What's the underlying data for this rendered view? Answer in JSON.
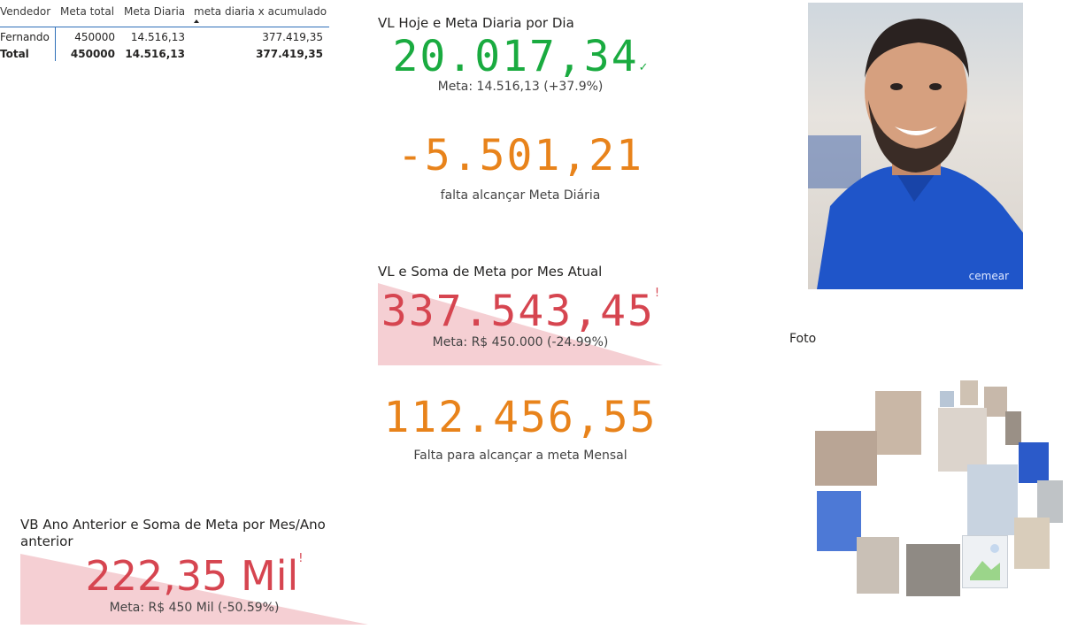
{
  "table": {
    "headers": [
      "Vendedor",
      "Meta total",
      "Meta Diaria",
      "meta diaria x acumulado"
    ],
    "rows": [
      {
        "vendedor": "Fernando",
        "meta_total": "450000",
        "meta_diaria": "14.516,13",
        "acumulado": "377.419,35"
      }
    ],
    "total": {
      "vendedor": "Total",
      "meta_total": "450000",
      "meta_diaria": "14.516,13",
      "acumulado": "377.419,35"
    }
  },
  "kpi_day": {
    "title": "VL Hoje e Meta Diaria por Dia",
    "value": "20.017,34",
    "status_mark": "✓",
    "goal": "Meta: 14.516,13 (+37.9%)",
    "color": "#1aab40"
  },
  "kpi_day_remaining": {
    "value": "-5.501,21",
    "label": "falta alcançar Meta Diária",
    "color": "#e8831b"
  },
  "kpi_month": {
    "title": "VL e Soma de Meta por Mes Atual",
    "value": "337.543,45",
    "status_mark": "!",
    "goal": "Meta: R$ 450.000 (-24.99%)",
    "color": "#d64550",
    "progress": 0.75
  },
  "kpi_month_remaining": {
    "value": "112.456,55",
    "label": "Falta para alcançar a meta Mensal",
    "color": "#e8831b"
  },
  "kpi_prev_year": {
    "title": "VB Ano Anterior e Soma de Meta por Mes/Ano anterior",
    "value": "222,35 Mil",
    "status_mark": "!",
    "goal": "Meta: R$ 450 Mil (-50.59%)",
    "color": "#d64550",
    "progress": 0.49
  },
  "photo": {
    "shirt_logo": "cemear"
  },
  "foto_label": "Foto"
}
